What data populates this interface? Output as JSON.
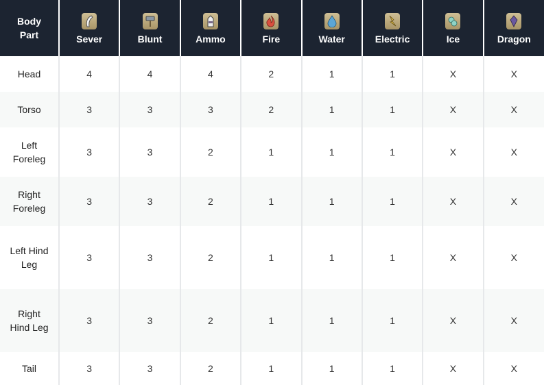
{
  "headers": {
    "part": "Body Part",
    "columns": [
      {
        "label": "Sever",
        "icon": "claw-slash-icon"
      },
      {
        "label": "Blunt",
        "icon": "hammer-icon"
      },
      {
        "label": "Ammo",
        "icon": "ammo-pouch-icon"
      },
      {
        "label": "Fire",
        "icon": "fire-icon"
      },
      {
        "label": "Water",
        "icon": "water-drop-icon"
      },
      {
        "label": "Electric",
        "icon": "thunder-icon"
      },
      {
        "label": "Ice",
        "icon": "ice-crystal-icon"
      },
      {
        "label": "Dragon",
        "icon": "dragon-gem-icon"
      }
    ]
  },
  "colors": {
    "header_bg": "#1c2431",
    "fire": "#c94b3c",
    "water": "#3f86b5",
    "electric": "#c9a33a",
    "ice": "#5ea59a",
    "dragon": "#5a4a7a"
  },
  "rows": [
    {
      "part": "Head",
      "values": [
        "4",
        "4",
        "4",
        "2",
        "1",
        "1",
        "X",
        "X"
      ]
    },
    {
      "part": "Torso",
      "values": [
        "3",
        "3",
        "3",
        "2",
        "1",
        "1",
        "X",
        "X"
      ]
    },
    {
      "part": "Left Foreleg",
      "values": [
        "3",
        "3",
        "2",
        "1",
        "1",
        "1",
        "X",
        "X"
      ]
    },
    {
      "part": "Right Foreleg",
      "values": [
        "3",
        "3",
        "2",
        "1",
        "1",
        "1",
        "X",
        "X"
      ]
    },
    {
      "part": "Left Hind Leg",
      "values": [
        "3",
        "3",
        "2",
        "1",
        "1",
        "1",
        "X",
        "X"
      ]
    },
    {
      "part": "Right Hind Leg",
      "values": [
        "3",
        "3",
        "2",
        "1",
        "1",
        "1",
        "X",
        "X"
      ]
    },
    {
      "part": "Tail",
      "values": [
        "3",
        "3",
        "2",
        "1",
        "1",
        "1",
        "X",
        "X"
      ]
    }
  ]
}
